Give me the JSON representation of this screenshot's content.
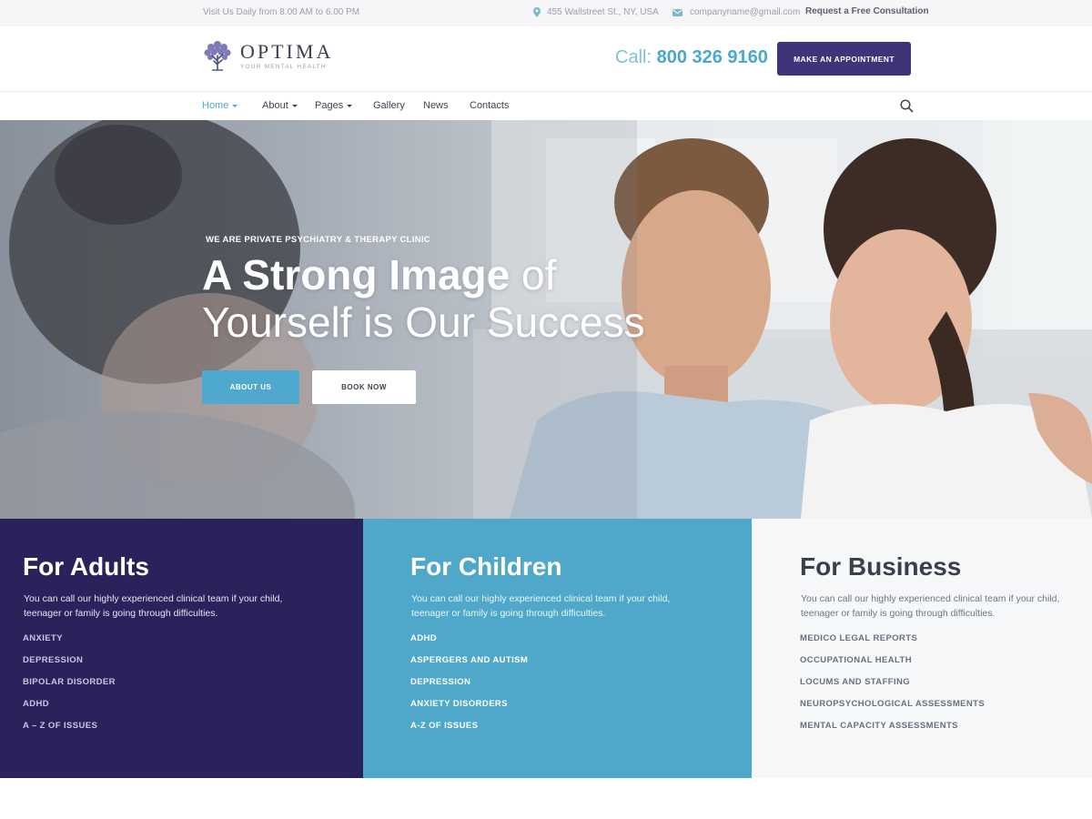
{
  "topbar": {
    "hours": "Visit Us Daily from 8.00 AM to 6.00 PM",
    "address": "455 Wallstreet St., NY, USA",
    "email": "companyname@gmail.com",
    "consultation_link": "Request a Free Consultation",
    "icons": {
      "address": "map-pin-icon",
      "email": "envelope-icon"
    }
  },
  "header": {
    "logo_name": "OPTIMA",
    "logo_tagline": "YOUR MENTAL HEALTH",
    "logo_icon": "tree-icon",
    "call_label": "Call:",
    "call_number": "800 326 9160",
    "appointment_button": "MAKE AN APPOINTMENT"
  },
  "nav": {
    "items": [
      {
        "label": "Home",
        "has_dropdown": true,
        "active": true
      },
      {
        "label": "About",
        "has_dropdown": true,
        "active": false
      },
      {
        "label": "Pages",
        "has_dropdown": true,
        "active": false
      },
      {
        "label": "Gallery",
        "has_dropdown": false,
        "active": false
      },
      {
        "label": "News",
        "has_dropdown": false,
        "active": false
      },
      {
        "label": "Contacts",
        "has_dropdown": false,
        "active": false
      }
    ],
    "search_icon": "search-icon"
  },
  "hero": {
    "kicker": "WE ARE PRIVATE PSYCHIATRY & THERAPY CLINIC",
    "title_strong": "A Strong Image",
    "title_light_1": " of",
    "title_line2": "Yourself is Our Success",
    "about_button": "ABOUT US",
    "book_button": "BOOK NOW"
  },
  "panels": {
    "adults": {
      "title": "For Adults",
      "text_line1": "You can call our highly experienced clinical team if your child,",
      "text_line2": "teenager or family is going through difficulties.",
      "items": [
        "ANXIETY",
        "DEPRESSION",
        "BIPOLAR DISORDER",
        "ADHD",
        "A – Z OF ISSUES"
      ]
    },
    "children": {
      "title": "For Children",
      "text_line1": "You can call our highly experienced clinical team if your child,",
      "text_line2": "teenager or family is going through difficulties.",
      "items": [
        "ADHD",
        "ASPERGERS AND AUTISM",
        "DEPRESSION",
        "ANXIETY DISORDERS",
        "A-Z OF ISSUES"
      ]
    },
    "business": {
      "title": "For Business",
      "text_line1": "You can call our highly experienced clinical team if your child,",
      "text_line2": "teenager or family is going through difficulties.",
      "items": [
        "MEDICO LEGAL REPORTS",
        "OCCUPATIONAL HEALTH",
        "LOCUMS AND STAFFING",
        "NEUROPSYCHOLOGICAL ASSESSMENTS",
        "MENTAL CAPACITY ASSESSMENTS"
      ]
    }
  },
  "colors": {
    "brand_dark": "#2a235b",
    "accent_blue": "#4fa8ca",
    "appointment_button": "#3d3479",
    "business_panel": "#f6f7f9"
  }
}
